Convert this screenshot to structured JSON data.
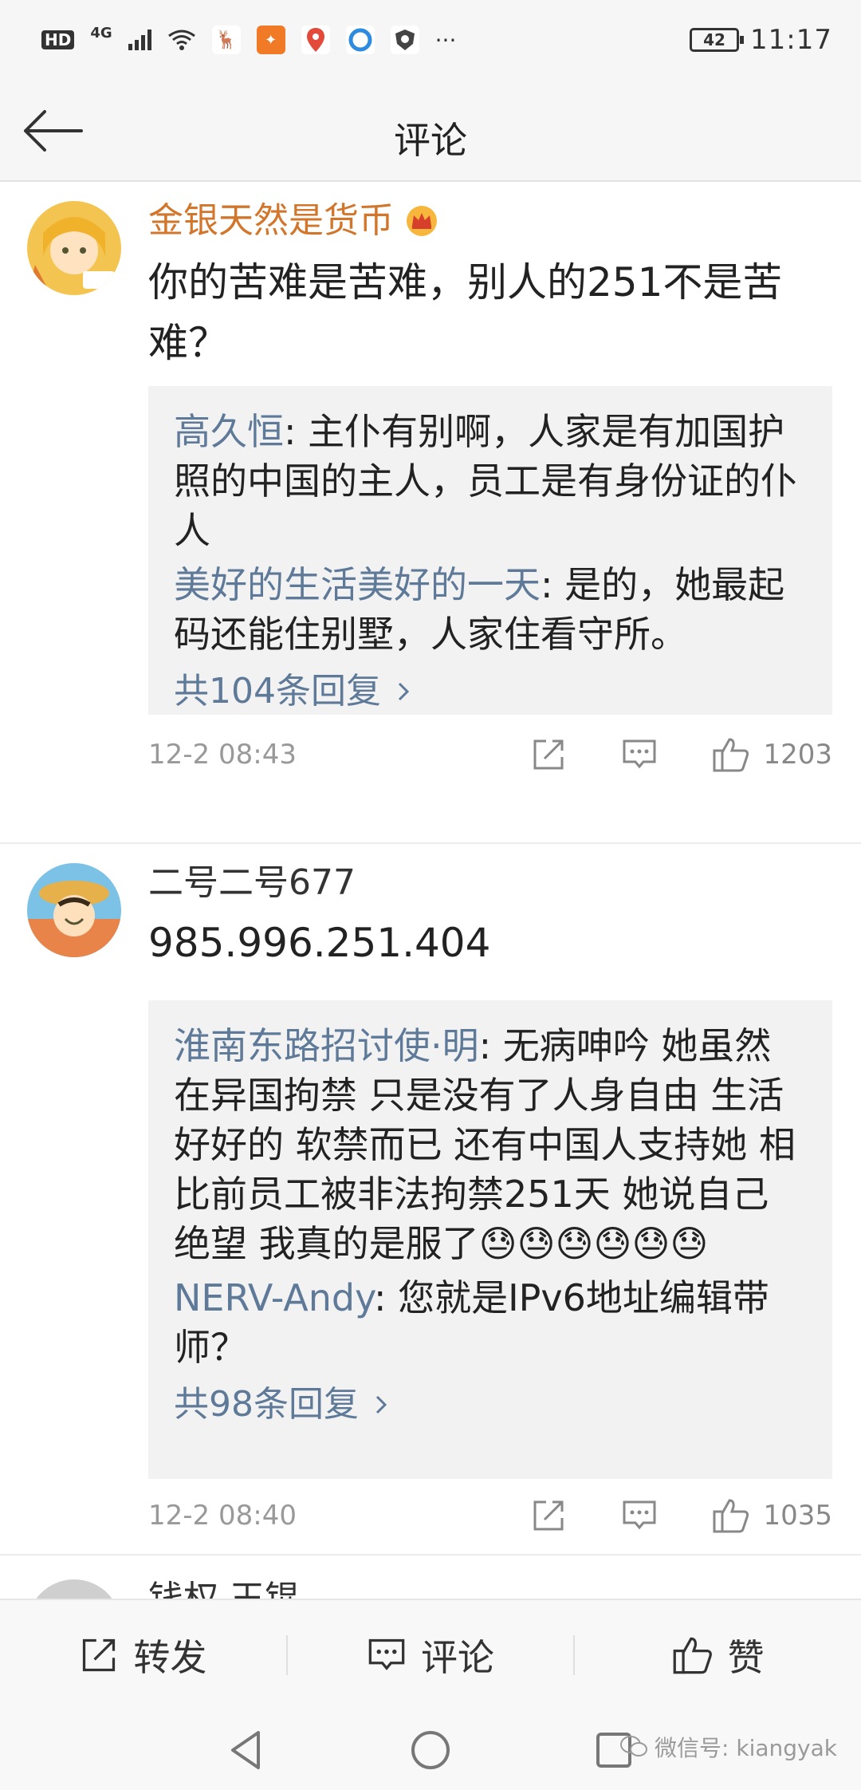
{
  "status_bar": {
    "hd": "HD",
    "network": "4G",
    "battery": "42",
    "time": "11:17",
    "more": "···",
    "app_icons": [
      "deer-app-icon",
      "orange-app-icon",
      "map-pin-app-icon",
      "blue-ring-app-icon",
      "shield-app-icon"
    ]
  },
  "nav": {
    "title": "评论",
    "back_icon": "arrow-left-icon"
  },
  "comments": [
    {
      "user": "金银天然是货币",
      "user_color": "#d2762c",
      "badge_icon": "crown-icon",
      "text": "你的苦难是苦难，别人的251不是苦难？",
      "replies": [
        {
          "name": "高久恒",
          "text": ": 主仆有别啊，人家是有加国护照的中国的主人，员工是有身份证的仆人"
        },
        {
          "name": "美好的生活美好的一天",
          "text": ": 是的，她最起码还能住别墅，人家住看守所。"
        }
      ],
      "more_replies": "共104条回复",
      "time": "12-2 08:43",
      "likes": "1203"
    },
    {
      "user": "二号二号677",
      "user_color": "#333333",
      "text": "985.996.251.404",
      "replies": [
        {
          "name": "淮南东路招讨使·明",
          "text": ": 无病呻吟 她虽然在异国拘禁 只是没有了人身自由 生活好好的 软禁而已 还有中国人支持她 相比前员工被非法拘禁251天 她说自己绝望 我真的是服了😓😓😓😓😓😓"
        },
        {
          "name": "NERV-Andy",
          "text": ": 您就是IPv6地址编辑带师？"
        }
      ],
      "more_replies": "共98条回复",
      "time": "12-2 08:40",
      "likes": "1035"
    },
    {
      "user": "钱权 王锟"
    }
  ],
  "bottom_bar": {
    "repost": "转发",
    "comment": "评论",
    "like": "赞"
  },
  "watermark": "微信号: kiangyak"
}
